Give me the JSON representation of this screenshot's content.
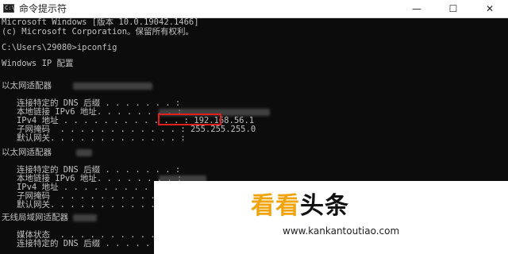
{
  "window": {
    "title": "命令提示符",
    "icon": "cmd-icon",
    "icon_glyph": "C:\\",
    "controls": {
      "minimize": "—",
      "maximize": "☐",
      "close": "✕"
    }
  },
  "console": {
    "lines": [
      "Microsoft Windows [版本 10.0.19042.1466]",
      "(c) Microsoft Corporation。保留所有权利。",
      "",
      "C:\\Users\\29080>ipconfig",
      "",
      "Windows IP 配置",
      "",
      "",
      "以太网适配器",
      "",
      "   连接特定的 DNS 后缀 . . . . . . . :",
      "   本地链接 IPv6 地址. . . . . . . . :",
      "   IPv4 地址 . . . . . . . . . . . . : 192.168.56.1",
      "   子网掩码  . . . . . . . . . . . . : 255.255.255.0",
      "   默认网关. . . . . . . . . . . . . :",
      "",
      "以太网适配器",
      "",
      "   连接特定的 DNS 后缀 . . . . . . . :",
      "   本地链接 IPv6 地址. . . . . . . . :",
      "   IPv4 地址 . . . . . . . . . . . . :",
      "   子网掩码  . . . . . . . . . . . . :",
      "   默认网关. . . . . . . . . . . . . :",
      "",
      "无线局域网适配器",
      "",
      "   媒体状态  . . . . . . . . . . . . :",
      "   连接特定的 DNS 后缀 . . . . . . . :"
    ],
    "highlighted_value": "192.168.56.1",
    "colors": {
      "background": "#0c0c0c",
      "text": "#c0c0c0",
      "highlight": "#e0201c"
    }
  },
  "watermark": {
    "logo_part1": "看看",
    "logo_part2": "头条",
    "url": "www.kankantoutiao.com",
    "colors": {
      "orange": "#f0a30a",
      "black": "#111111"
    }
  }
}
